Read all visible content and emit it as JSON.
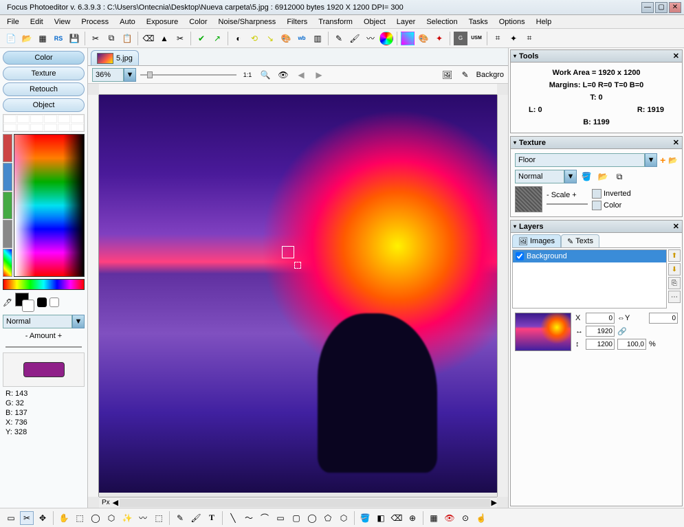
{
  "titlebar": {
    "text": "Focus Photoeditor v. 6.3.9.3 :  C:\\Users\\Ontecnia\\Desktop\\Nueva carpeta\\5.jpg : 6912000 bytes       1920 X 1200 DPI= 300"
  },
  "menu": {
    "file": "File",
    "edit": "Edit",
    "view": "View",
    "process": "Process",
    "auto": "Auto",
    "exposure": "Exposure",
    "color": "Color",
    "noise": "Noise/Sharpness",
    "filters": "Filters",
    "transform": "Transform",
    "object": "Object",
    "layer": "Layer",
    "selection": "Selection",
    "tasks": "Tasks",
    "options": "Options",
    "help": "Help"
  },
  "left": {
    "pill_color": "Color",
    "pill_texture": "Texture",
    "pill_retouch": "Retouch",
    "pill_object": "Object",
    "blend_mode": "Normal",
    "amount_label": "- Amount +",
    "readout": {
      "r": "R: 143",
      "g": "G: 32",
      "b": "B: 137",
      "x": "X: 736",
      "y": "Y: 328"
    },
    "current_color_hex": "#8f2089"
  },
  "doc": {
    "tab_name": "5.jpg"
  },
  "zoom": {
    "value": "36%",
    "btn_11": "1:1",
    "background": "Backgro"
  },
  "ruler_unit": "Px",
  "tools_panel": {
    "title": "Tools",
    "work_area": "Work Area = 1920 x 1200",
    "margins": "Margins: L=0 R=0 T=0 B=0",
    "t": "T: 0",
    "l": "L: 0",
    "r": "R: 1919",
    "b": "B: 1199"
  },
  "texture_panel": {
    "title": "Texture",
    "preset": "Floor",
    "mode": "Normal",
    "scale_label": "- Scale +",
    "opt_inverted": "Inverted",
    "opt_color": "Color"
  },
  "layers_panel": {
    "title": "Layers",
    "tab_images": "Images",
    "tab_texts": "Texts",
    "item0": "Background",
    "x_label": "X",
    "y_label": "Y",
    "x_val": "0",
    "y_val": "0",
    "w_val": "1920",
    "h_val": "1200",
    "opacity_val": "100,0",
    "opacity_pct": "%"
  }
}
